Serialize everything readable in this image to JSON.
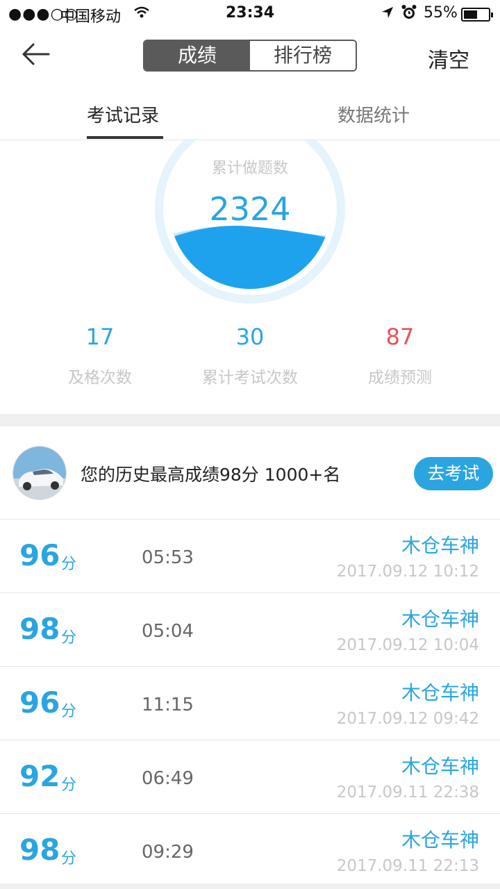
{
  "status_bar": {
    "signal": "●●●○○",
    "carrier": "中国移动",
    "time": "23:34",
    "battery_pct": "55%",
    "battery_level": 0.55
  },
  "nav": {
    "seg_active": "成绩",
    "seg_inactive": "排行榜",
    "clear": "清空"
  },
  "tabs": {
    "records": "考试记录",
    "stats": "数据统计"
  },
  "gauge": {
    "label": "累计做题数",
    "value": "2324"
  },
  "stats": [
    {
      "num": "17",
      "label": "及格次数"
    },
    {
      "num": "30",
      "label": "累计考试次数"
    },
    {
      "num": "87",
      "label": "成绩预测"
    }
  ],
  "best": {
    "text": "您的历史最高成绩98分  1000+名",
    "button": "去考试"
  },
  "records": [
    {
      "score": "96",
      "unit": "分",
      "duration": "05:53",
      "name": "木仓车神",
      "date": "2017.09.12 10:12"
    },
    {
      "score": "98",
      "unit": "分",
      "duration": "05:04",
      "name": "木仓车神",
      "date": "2017.09.12 10:04"
    },
    {
      "score": "96",
      "unit": "分",
      "duration": "11:15",
      "name": "木仓车神",
      "date": "2017.09.12 09:42"
    },
    {
      "score": "92",
      "unit": "分",
      "duration": "06:49",
      "name": "木仓车神",
      "date": "2017.09.11 22:38"
    },
    {
      "score": "98",
      "unit": "分",
      "duration": "09:29",
      "name": "木仓车神",
      "date": "2017.09.11 22:13"
    }
  ],
  "colors": {
    "accent": "#2aa5e0",
    "danger": "#e25555",
    "muted": "#c7c7c7"
  }
}
